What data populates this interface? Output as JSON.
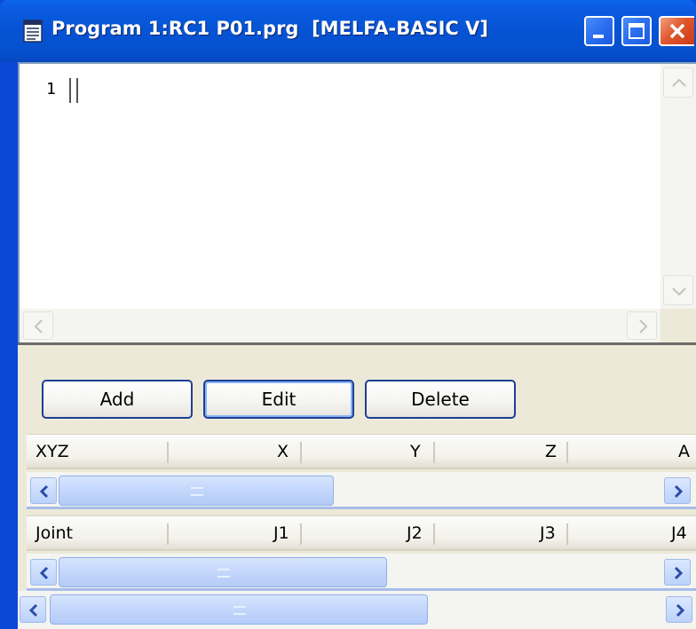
{
  "window": {
    "title": "Program 1:RC1 P01.prg  [MELFA-BASIC V]",
    "icon": "document-icon",
    "controls": {
      "minimize": "minimize-icon",
      "maximize": "maximize-icon",
      "close": "close-icon"
    },
    "colors": {
      "titlebar": "#0653d4",
      "close": "#e0582e",
      "face": "#ece9d8"
    }
  },
  "editor": {
    "line_number": "1",
    "content": ""
  },
  "toolbar": {
    "add_label": "Add",
    "edit_label": "Edit",
    "delete_label": "Delete"
  },
  "xyz_list": {
    "columns": [
      "XYZ",
      "X",
      "Y",
      "Z",
      "A"
    ]
  },
  "joint_list": {
    "columns": [
      "Joint",
      "J1",
      "J2",
      "J3",
      "J4"
    ]
  }
}
